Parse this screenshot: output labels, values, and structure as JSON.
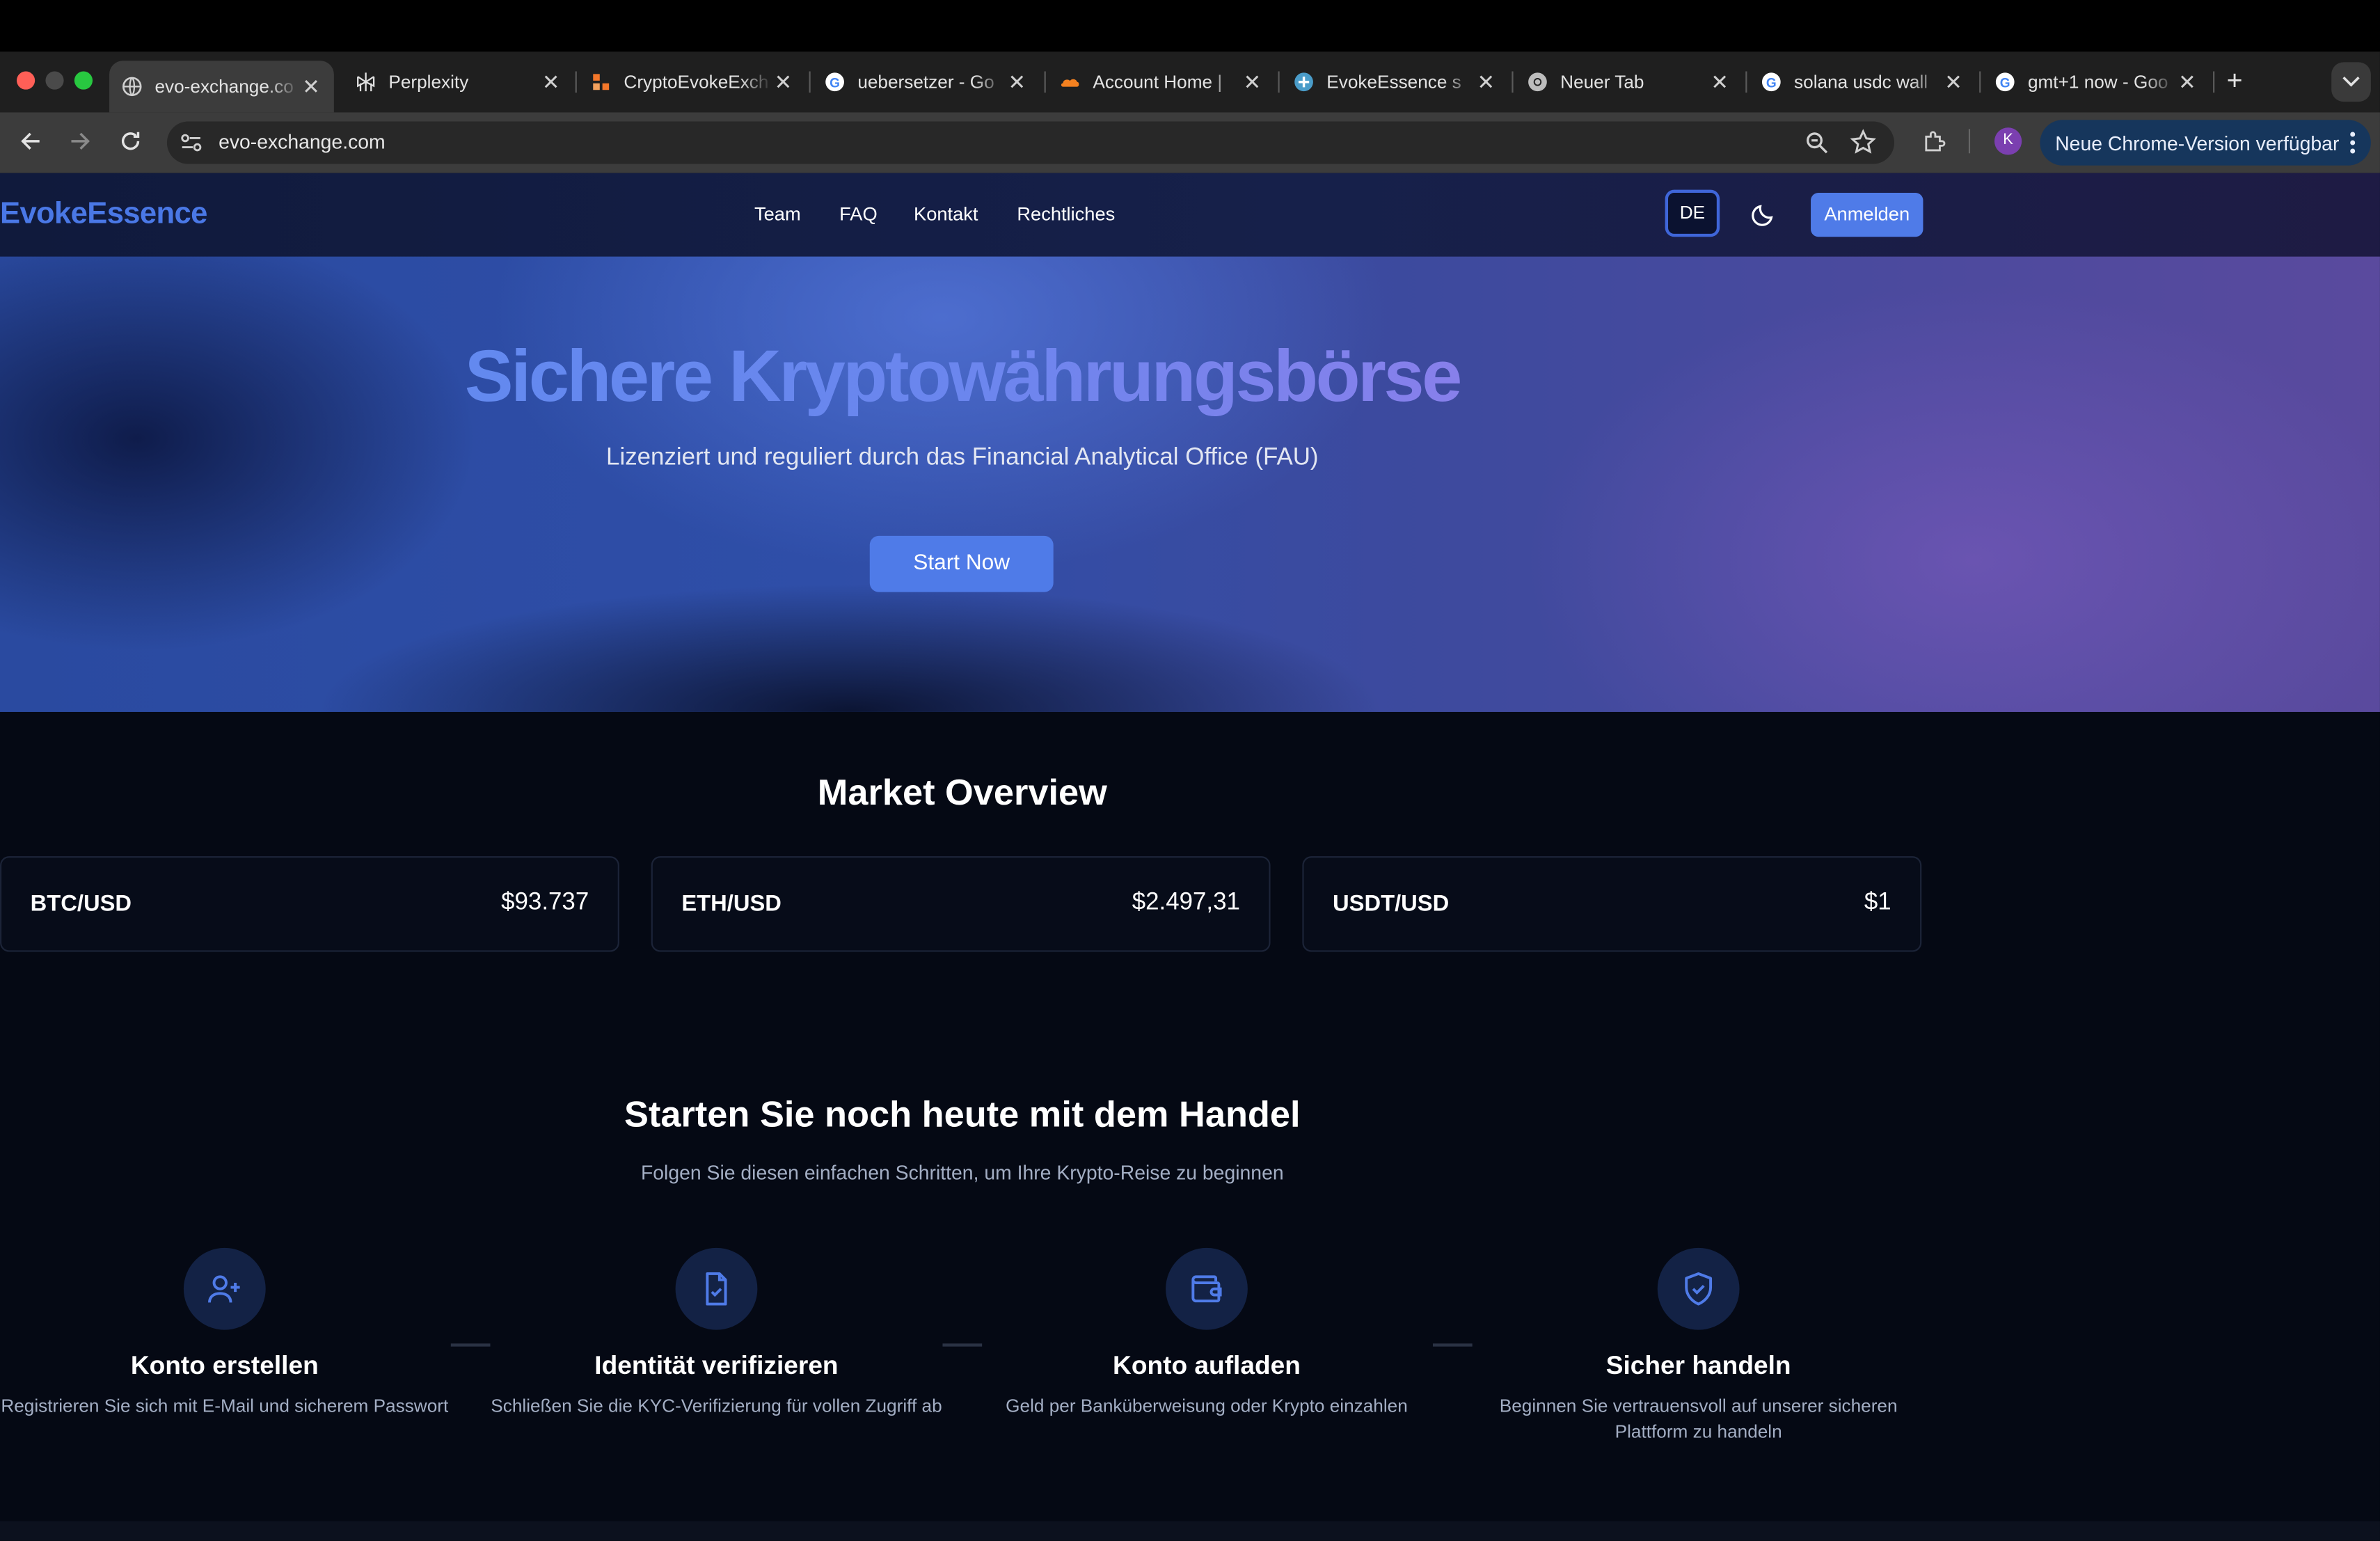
{
  "browser": {
    "tabs": [
      {
        "title": "evo-exchange.co",
        "favicon": "globe-icon",
        "active": true
      },
      {
        "title": "Perplexity",
        "favicon": "perplexity-icon"
      },
      {
        "title": "CryptoEvokeExch",
        "favicon": "app-icon"
      },
      {
        "title": "uebersetzer - Go",
        "favicon": "google-icon"
      },
      {
        "title": "Account Home | ",
        "favicon": "cloud-icon"
      },
      {
        "title": "EvokeEssence s",
        "favicon": "plus-circle-icon"
      },
      {
        "title": "Neuer Tab",
        "favicon": "chrome-icon"
      },
      {
        "title": "solana usdc wall",
        "favicon": "google-icon"
      },
      {
        "title": "gmt+1 now - Goo",
        "favicon": "google-icon"
      }
    ],
    "new_tab_symbol": "+",
    "url": "evo-exchange.com",
    "profile_initial": "K",
    "update_label": "Neue Chrome-Version verfügbar"
  },
  "site": {
    "logo": "EvokeEssence",
    "nav": [
      "Team",
      "FAQ",
      "Kontakt",
      "Rechtliches"
    ],
    "language": "DE",
    "login_label": "Anmelden",
    "colors": {
      "accent": "#4f7be8",
      "logo": "#4a78e6"
    }
  },
  "hero": {
    "title": "Sichere Kryptowährungsbörse",
    "subtitle": "Lizenziert und reguliert durch das Financial Analytical Office (FAU)",
    "cta": "Start Now"
  },
  "market": {
    "heading": "Market Overview",
    "pairs": [
      {
        "pair": "BTC/USD",
        "price": "$93.737"
      },
      {
        "pair": "ETH/USD",
        "price": "$2.497,31"
      },
      {
        "pair": "USDT/USD",
        "price": "$1"
      }
    ]
  },
  "steps": {
    "heading": "Starten Sie noch heute mit dem Handel",
    "subheading": "Folgen Sie diesen einfachen Schritten, um Ihre Krypto-Reise zu beginnen",
    "items": [
      {
        "icon": "user-plus-icon",
        "title": "Konto erstellen",
        "desc": "Registrieren Sie sich mit E-Mail und sicherem Passwort"
      },
      {
        "icon": "file-check-icon",
        "title": "Identität verifizieren",
        "desc": "Schließen Sie die KYC-Verifizierung für vollen Zugriff ab"
      },
      {
        "icon": "wallet-icon",
        "title": "Konto aufladen",
        "desc": "Geld per Banküberweisung oder Krypto einzahlen"
      },
      {
        "icon": "shield-check-icon",
        "title": "Sicher handeln",
        "desc": "Beginnen Sie vertrauensvoll auf unserer sicheren Plattform zu handeln"
      }
    ]
  }
}
